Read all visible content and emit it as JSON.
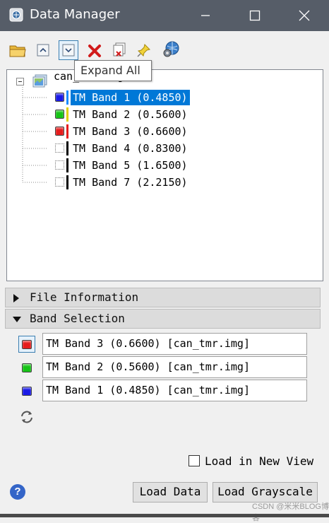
{
  "window": {
    "title": "Data Manager"
  },
  "tooltip": {
    "text": "Expand All"
  },
  "tree": {
    "root": "can_tmr.img",
    "bands": [
      {
        "label": "TM Band 1 (0.4850)",
        "color": "#1a1ae6",
        "bar_color": "#1a8cff",
        "checked": true,
        "selected": true
      },
      {
        "label": "TM Band 2 (0.5600)",
        "color": "#16c416",
        "bar_color": "#e0d000",
        "checked": true,
        "selected": false
      },
      {
        "label": "TM Band 3 (0.6600)",
        "color": "#e61c1c",
        "bar_color": "#e61c1c",
        "checked": true,
        "selected": false
      },
      {
        "label": "TM Band 4 (0.8300)",
        "color": "",
        "bar_color": "#000000",
        "checked": false,
        "selected": false
      },
      {
        "label": "TM Band 5 (1.6500)",
        "color": "",
        "bar_color": "#000000",
        "checked": false,
        "selected": false
      },
      {
        "label": "TM Band 7 (2.2150)",
        "color": "",
        "bar_color": "#000000",
        "checked": false,
        "selected": false
      }
    ]
  },
  "sections": {
    "file_info": "File Information",
    "band_selection": "Band Selection"
  },
  "band_selection": [
    {
      "color": "#e61c1c",
      "value": "TM Band 3 (0.6600) [can_tmr.img]"
    },
    {
      "color": "#16c416",
      "value": "TM Band 2 (0.5600) [can_tmr.img]"
    },
    {
      "color": "#1a1ae6",
      "value": "TM Band 1 (0.4850) [can_tmr.img]"
    }
  ],
  "options": {
    "load_new_view": "Load in New View"
  },
  "buttons": {
    "load_data": "Load Data",
    "load_grayscale": "Load Grayscale"
  },
  "watermark": "CSDN @米米BLOG博客"
}
